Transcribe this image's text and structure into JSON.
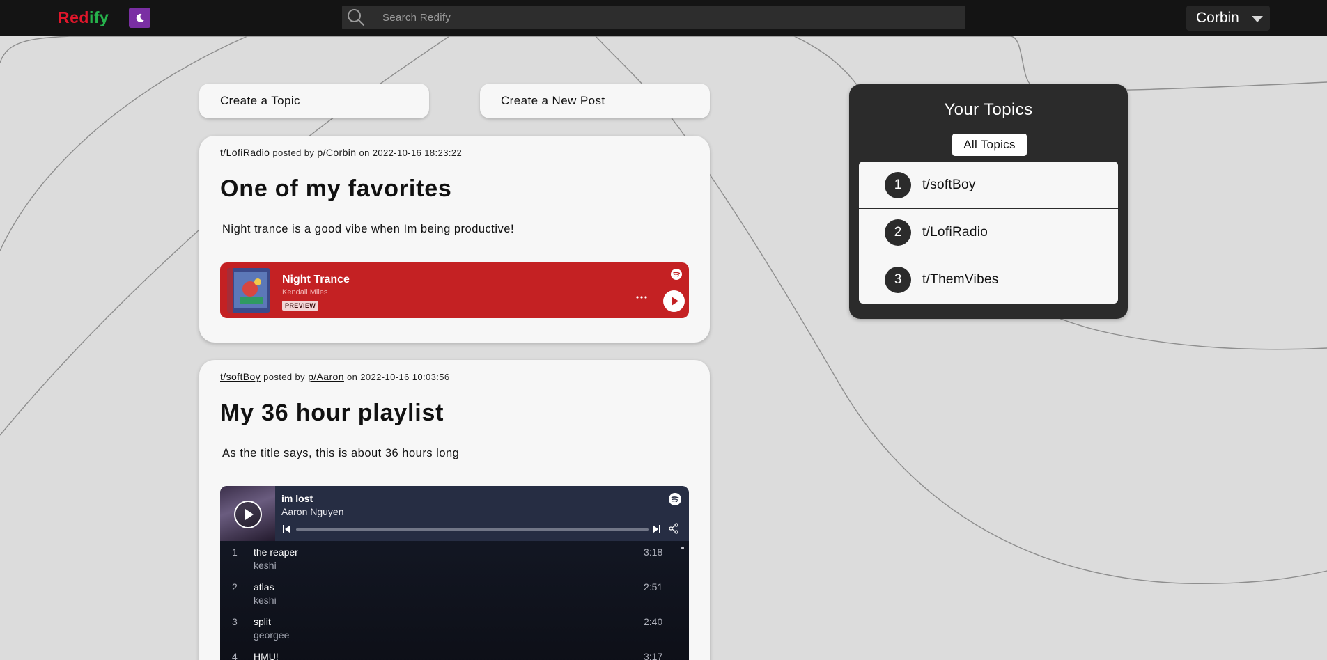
{
  "brand": {
    "part1": "Red",
    "part2": "ify"
  },
  "icons": {
    "theme_toggle": "moon-icon",
    "search": "search-icon",
    "user_menu": "chevron-down-icon"
  },
  "colors": {
    "brand_red": "#e0162b",
    "brand_green": "#26b24b",
    "theme_button": "#7a2fa3",
    "track_embed": "#c42123"
  },
  "search": {
    "placeholder": "Search Redify"
  },
  "user": {
    "name": "Corbin"
  },
  "actions": {
    "create_topic": "Create a Topic",
    "create_post": "Create a New Post"
  },
  "posts": [
    {
      "topic": "t/LofiRadio",
      "posted_by_label": "posted by",
      "author": "p/Corbin",
      "on_label": "on",
      "timestamp": "2022-10-16 18:23:22",
      "title": "One of my favorites",
      "body": "Night trance is a good vibe when Im being productive!",
      "embed": {
        "type": "track",
        "title": "Night Trance",
        "artist": "Kendall Miles",
        "badge": "PREVIEW"
      }
    },
    {
      "topic": "t/softBoy",
      "posted_by_label": "posted by",
      "author": "p/Aaron",
      "on_label": "on",
      "timestamp": "2022-10-16 10:03:56",
      "title": "My 36 hour playlist",
      "body": "As the title says, this is about 36 hours long",
      "embed": {
        "type": "playlist",
        "current_title": "im lost",
        "current_artist": "Aaron Nguyen",
        "tracks": [
          {
            "num": "1",
            "name": "the reaper",
            "artist": "keshi",
            "duration": "3:18"
          },
          {
            "num": "2",
            "name": "atlas",
            "artist": "keshi",
            "duration": "2:51"
          },
          {
            "num": "3",
            "name": "split",
            "artist": "georgee",
            "duration": "2:40"
          },
          {
            "num": "4",
            "name": "HMU!",
            "artist": "",
            "duration": "3:17"
          }
        ]
      }
    }
  ],
  "sidebar": {
    "title": "Your Topics",
    "filter_label": "All Topics",
    "topics": [
      {
        "rank": "1",
        "name": "t/softBoy"
      },
      {
        "rank": "2",
        "name": "t/LofiRadio"
      },
      {
        "rank": "3",
        "name": "t/ThemVibes"
      }
    ]
  }
}
